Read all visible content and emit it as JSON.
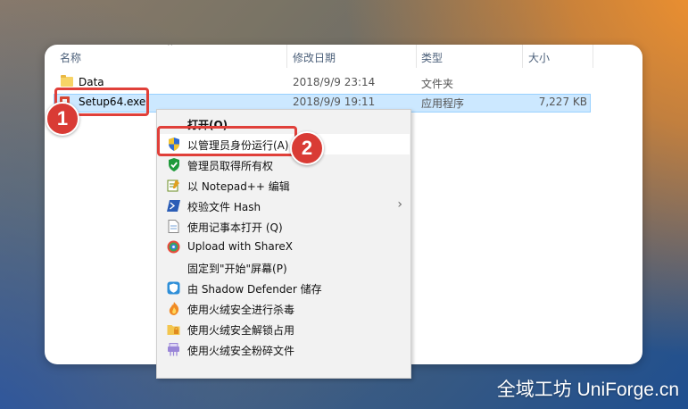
{
  "columns": {
    "name": "名称",
    "modified": "修改日期",
    "type": "类型",
    "size": "大小"
  },
  "files": [
    {
      "name": "Data",
      "modified": "2018/9/9 23:14",
      "type": "文件夹",
      "size": "",
      "icon": "folder-icon"
    },
    {
      "name": "Setup64.exe",
      "modified": "2018/9/9 19:11",
      "type": "应用程序",
      "size": "7,227 KB",
      "icon": "exe-icon"
    }
  ],
  "context_menu": {
    "items": [
      {
        "label": "打开(O)",
        "icon": "none"
      },
      {
        "label": "以管理员身份运行(A)",
        "icon": "uac-shield-icon"
      },
      {
        "label": "管理员取得所有权",
        "icon": "green-shield-icon"
      },
      {
        "label": "以 Notepad++ 编辑",
        "icon": "notepad-icon"
      },
      {
        "label": "校验文件 Hash",
        "icon": "powershell-icon",
        "submenu": true
      },
      {
        "label": "使用记事本打开 (Q)",
        "icon": "document-icon"
      },
      {
        "label": "Upload with ShareX",
        "icon": "sharex-icon"
      },
      {
        "label": "固定到\"开始\"屏幕(P)",
        "icon": "none"
      },
      {
        "label": "由 Shadow Defender 储存",
        "icon": "shadow-defender-icon"
      },
      {
        "label": "使用火绒安全进行杀毒",
        "icon": "huorong-icon"
      },
      {
        "label": "使用火绒安全解锁占用",
        "icon": "folder-lock-icon"
      },
      {
        "label": "使用火绒安全粉碎文件",
        "icon": "shred-icon"
      }
    ]
  },
  "badges": [
    "1",
    "2"
  ],
  "watermark": "全域工坊 UniForge.cn",
  "colors": {
    "badge": "#d93b35",
    "highlight": "#e0403a",
    "selection": "#cce8ff"
  }
}
